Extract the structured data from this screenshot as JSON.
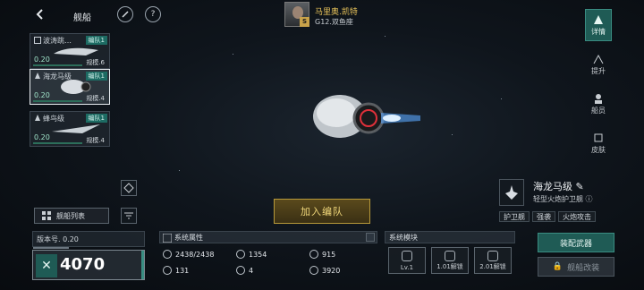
{
  "header": {
    "title": "舰船"
  },
  "commander": {
    "name": "马里奥.凯特",
    "location": "G12.双鱼座",
    "badge": "S"
  },
  "ships": [
    {
      "name": "波涛跳…",
      "tag": "编队1",
      "score": "0.20",
      "scale": "规模.6"
    },
    {
      "name": "海龙马级",
      "tag": "编队1",
      "score": "0.20",
      "scale": "规模.4"
    },
    {
      "name": "蜂鸟级",
      "tag": "编队1",
      "score": "0.20",
      "scale": "规模.4"
    }
  ],
  "ship_list_label": "舰船列表",
  "side_nav": [
    {
      "label": "详情",
      "icon": "details-icon"
    },
    {
      "label": "提升",
      "icon": "upgrade-icon"
    },
    {
      "label": "船员",
      "icon": "crew-icon"
    },
    {
      "label": "皮肤",
      "icon": "skin-icon"
    }
  ],
  "class_info": {
    "name": "海龙马级",
    "type": "轻型火炮护卫舰"
  },
  "traits": [
    "护卫舰",
    "强袭",
    "火炮攻击"
  ],
  "join_fleet_label": "加入编队",
  "version": {
    "label": "版本号. 0.20"
  },
  "power": {
    "value": "4070",
    "prefix": "✕"
  },
  "attributes": {
    "title": "系统属性",
    "items": [
      {
        "icon": "armor-icon",
        "value": "2438/2438"
      },
      {
        "icon": "shield-icon",
        "value": "1354"
      },
      {
        "icon": "speed-icon",
        "value": "915"
      },
      {
        "icon": "energy-icon",
        "value": "131"
      },
      {
        "icon": "slots-icon",
        "value": "4"
      },
      {
        "icon": "range-icon",
        "value": "3920"
      }
    ]
  },
  "modules": {
    "title": "系统模块",
    "slots": [
      {
        "label": "Lv.1"
      },
      {
        "label": "1.01解锁"
      },
      {
        "label": "2.01解锁"
      }
    ]
  },
  "equip_label": "装配武器",
  "modify_label": "舰船改装",
  "colors": {
    "accent": "#1f5b55",
    "gold": "#e8c35a",
    "tag": "#1d6b63"
  }
}
